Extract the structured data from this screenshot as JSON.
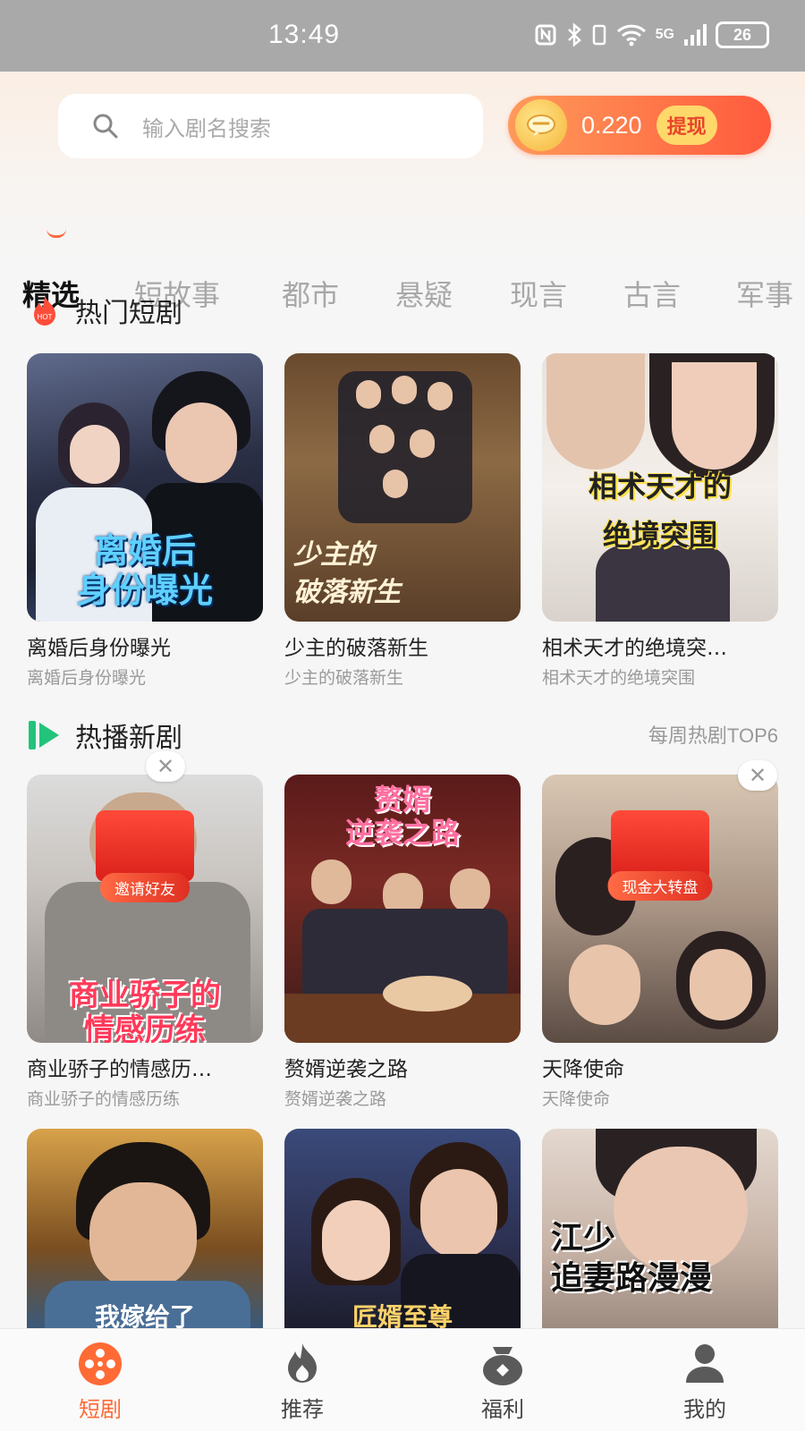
{
  "status_bar": {
    "time": "13:49",
    "network": "5G",
    "battery": "26"
  },
  "search": {
    "placeholder": "输入剧名搜索"
  },
  "wallet": {
    "amount": "0.220",
    "withdraw_label": "提现"
  },
  "tabs": [
    "精选",
    "短故事",
    "都市",
    "悬疑",
    "现言",
    "古言",
    "军事"
  ],
  "hot_section": {
    "badge": "HOT",
    "title": "热门短剧",
    "items": [
      {
        "title": "离婚后身份曝光",
        "subtitle": "离婚后身份曝光",
        "poster_text": "离婚后\n身份曝光"
      },
      {
        "title": "少主的破落新生",
        "subtitle": "少主的破落新生",
        "poster_text": "少主的\n破落新生"
      },
      {
        "title": "相术天才的绝境突…",
        "subtitle": "相术天才的绝境突围",
        "poster_text": "相术天才的\n绝境突围"
      }
    ]
  },
  "new_section": {
    "title": "热播新剧",
    "more": "每周热剧TOP6",
    "items": [
      {
        "title": "商业骄子的情感历…",
        "subtitle": "商业骄子的情感历练",
        "poster_text": "商业骄子的\n情感历练",
        "promo": "邀请好友"
      },
      {
        "title": "赘婿逆袭之路",
        "subtitle": "赘婿逆袭之路",
        "poster_text": "赘婿\n逆袭之路"
      },
      {
        "title": "天降使命",
        "subtitle": "天降使命",
        "promo": "现金大转盘"
      }
    ]
  },
  "more_row": [
    {
      "poster_text": "我嫁给了"
    },
    {
      "poster_text": "匠婿至尊"
    },
    {
      "poster_text": "江少\n追妻路漫漫"
    }
  ],
  "bottom_nav": [
    {
      "label": "短剧",
      "icon": "film-reel-icon"
    },
    {
      "label": "推荐",
      "icon": "flame-icon"
    },
    {
      "label": "福利",
      "icon": "gift-bag-icon"
    },
    {
      "label": "我的",
      "icon": "person-icon"
    }
  ],
  "colors": {
    "accent": "#ff6a35",
    "coin_pill_start": "#ff9a5a",
    "coin_pill_end": "#ff5a3c"
  }
}
